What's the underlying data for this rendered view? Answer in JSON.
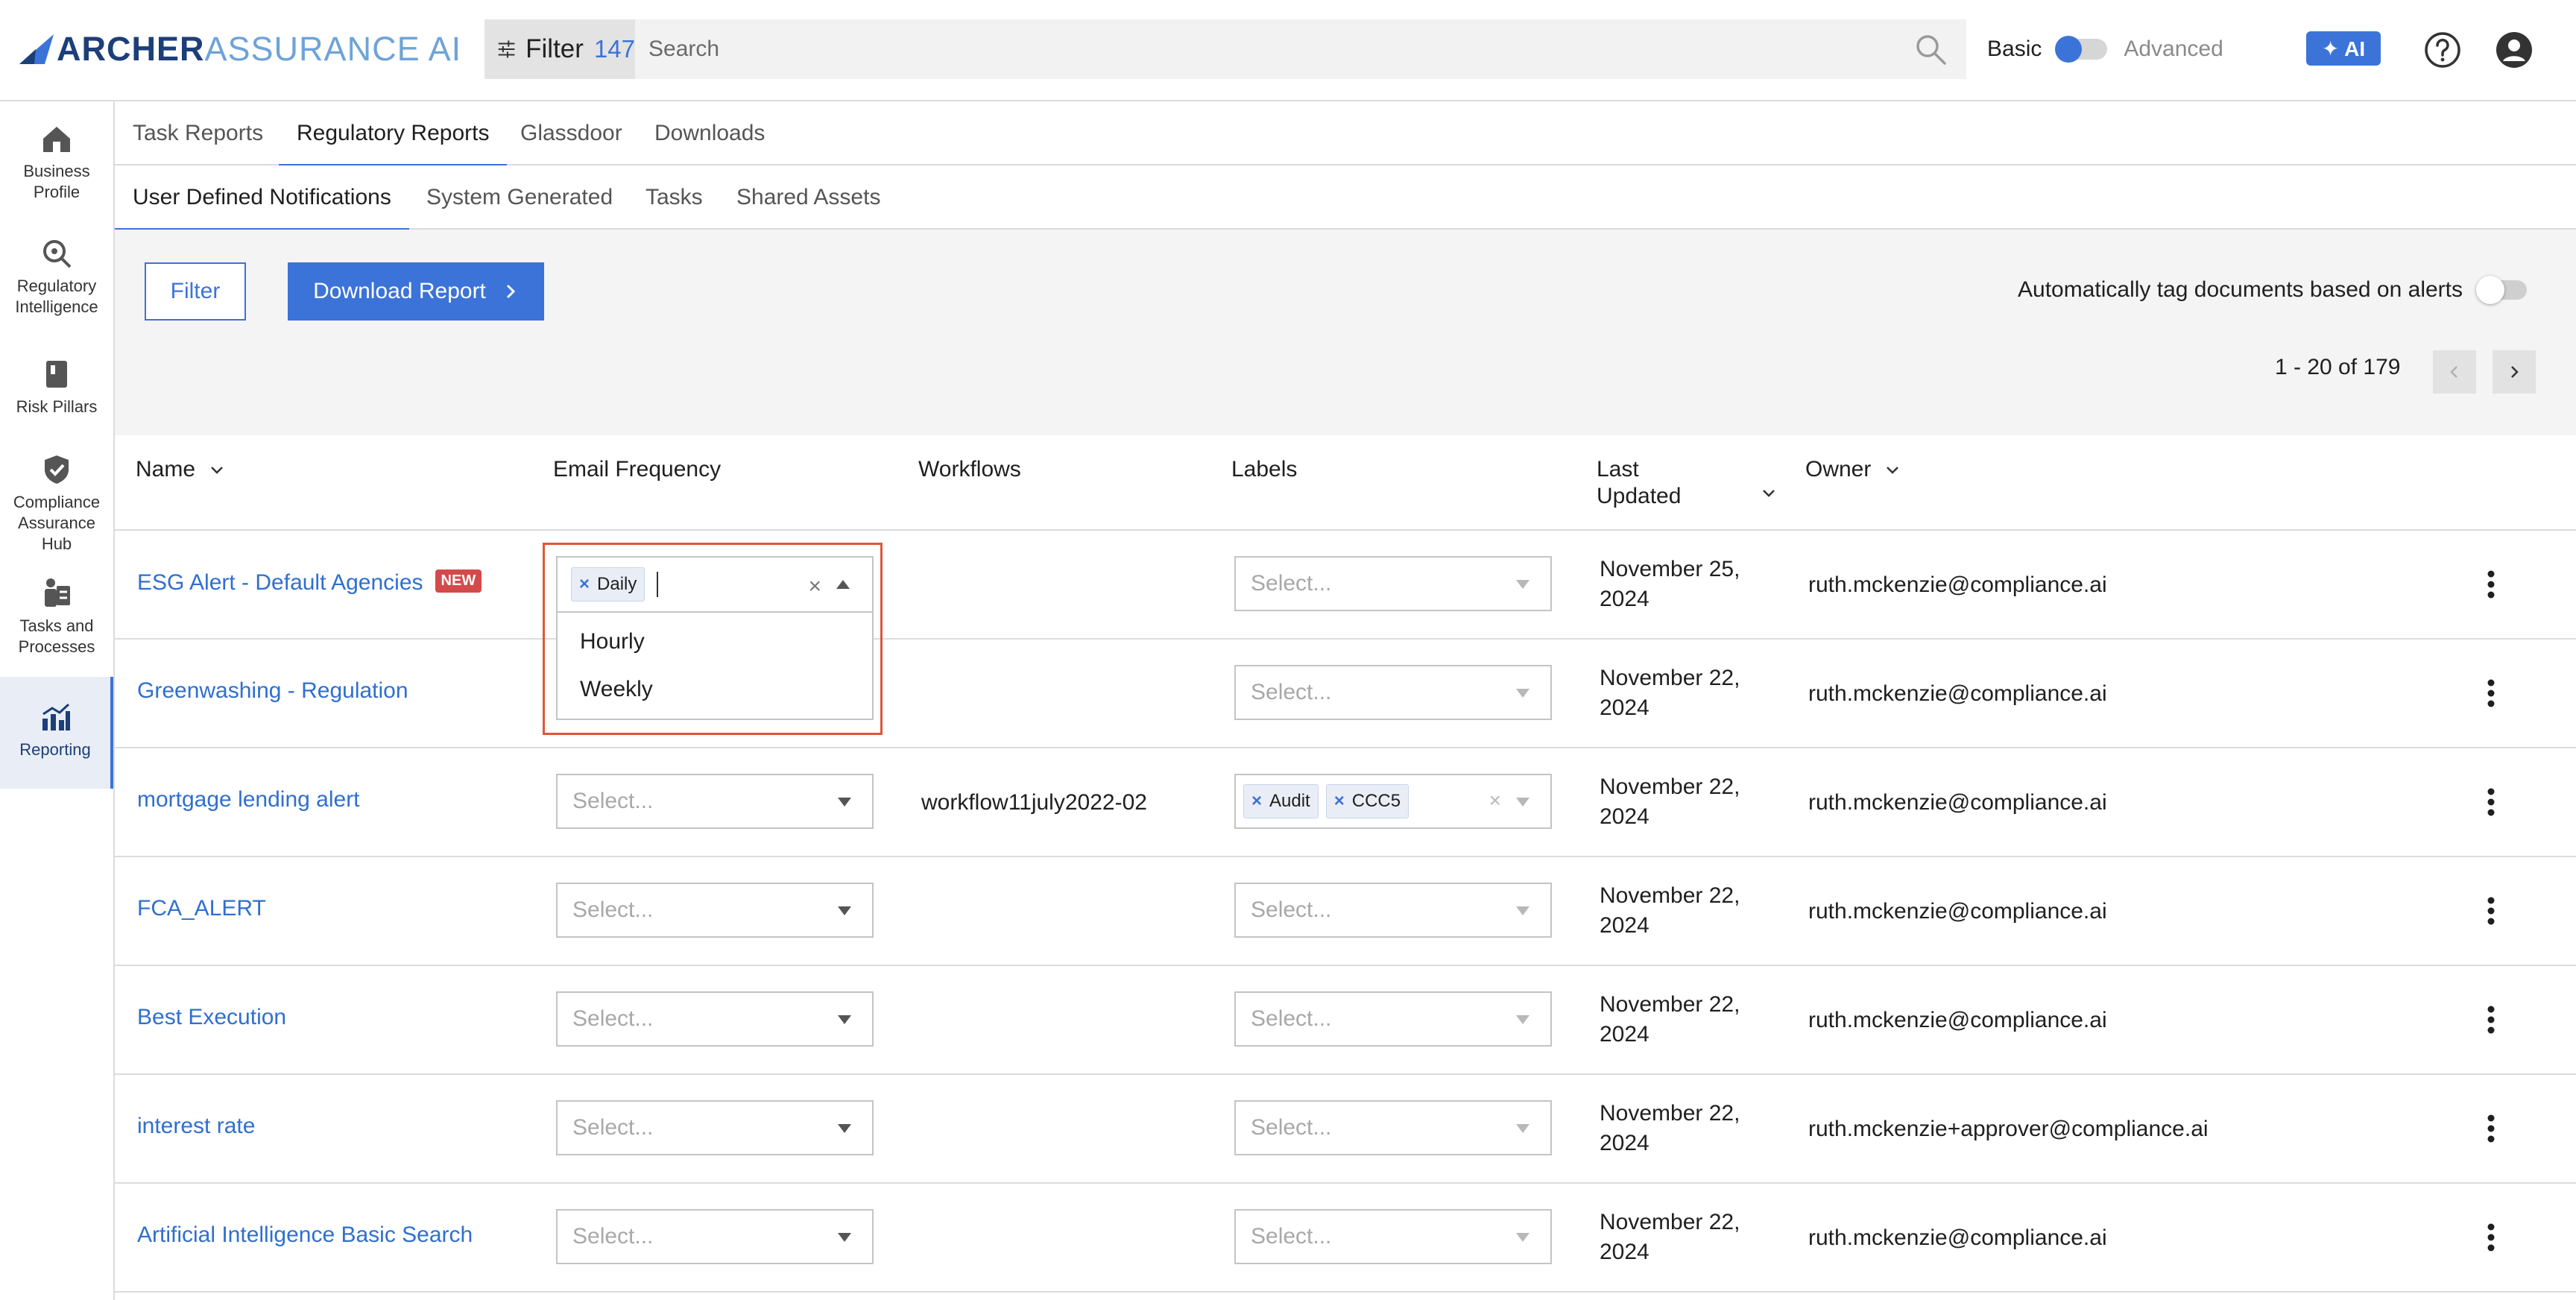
{
  "app": {
    "logo_primary": "ARCHER",
    "logo_secondary": "ASSURANCE AI"
  },
  "topbar": {
    "filter_label": "Filter",
    "filter_count": "147",
    "search_placeholder": "Search",
    "mode_basic": "Basic",
    "mode_advanced": "Advanced",
    "mode_selected": "Basic",
    "ai_label": "✦ AI",
    "accent_color": "#3b73d8"
  },
  "sidebar": {
    "items": [
      {
        "label": "Business Profile",
        "icon": "home-icon"
      },
      {
        "label": "Regulatory Intelligence",
        "icon": "magnifier-icon"
      },
      {
        "label": "Risk Pillars",
        "icon": "book-icon"
      },
      {
        "label": "Compliance Assurance Hub",
        "icon": "shield-check-icon"
      },
      {
        "label": "Tasks and Processes",
        "icon": "tasks-icon"
      },
      {
        "label": "Reporting",
        "icon": "chart-icon",
        "active": true
      }
    ]
  },
  "tabs": {
    "primary": [
      "Task Reports",
      "Regulatory Reports",
      "Glassdoor",
      "Downloads"
    ],
    "primary_active": "Regulatory Reports",
    "secondary": [
      "User Defined Notifications",
      "System Generated",
      "Tasks",
      "Shared Assets"
    ],
    "secondary_active": "User Defined Notifications"
  },
  "toolbar": {
    "filter_button": "Filter",
    "download_button": "Download Report",
    "autotag_label": "Automatically tag documents based on alerts",
    "autotag_enabled": false,
    "pagination": "1 - 20 of 179"
  },
  "table": {
    "headers": {
      "name": "Name",
      "email_frequency": "Email Frequency",
      "workflows": "Workflows",
      "labels": "Labels",
      "last_updated": "Last Updated",
      "owner": "Owner"
    },
    "select_placeholder": "Select...",
    "rows": [
      {
        "name": "ESG Alert - Default Agencies",
        "badge": "NEW",
        "email_frequency": [
          "Daily"
        ],
        "workflow": "",
        "labels": [],
        "last_updated_l1": "November 25,",
        "last_updated_l2": "2024",
        "owner": "ruth.mckenzie@compliance.ai"
      },
      {
        "name": "Greenwashing - Regulation",
        "badge": "",
        "email_frequency": [],
        "workflow": "",
        "labels": [],
        "last_updated_l1": "November 22,",
        "last_updated_l2": "2024",
        "owner": "ruth.mckenzie@compliance.ai"
      },
      {
        "name": "mortgage lending alert",
        "badge": "",
        "email_frequency": [],
        "workflow": "workflow11july2022-02",
        "labels": [
          "Audit",
          "CCC5"
        ],
        "last_updated_l1": "November 22,",
        "last_updated_l2": "2024",
        "owner": "ruth.mckenzie@compliance.ai"
      },
      {
        "name": "FCA_ALERT",
        "badge": "",
        "email_frequency": [],
        "workflow": "",
        "labels": [],
        "last_updated_l1": "November 22,",
        "last_updated_l2": "2024",
        "owner": "ruth.mckenzie@compliance.ai"
      },
      {
        "name": "Best Execution",
        "badge": "",
        "email_frequency": [],
        "workflow": "",
        "labels": [],
        "last_updated_l1": "November 22,",
        "last_updated_l2": "2024",
        "owner": "ruth.mckenzie@compliance.ai"
      },
      {
        "name": "interest rate",
        "badge": "",
        "email_frequency": [],
        "workflow": "",
        "labels": [],
        "last_updated_l1": "November 22,",
        "last_updated_l2": "2024",
        "owner": "ruth.mckenzie+approver@compliance.ai"
      },
      {
        "name": "Artificial Intelligence Basic Search",
        "badge": "",
        "email_frequency": [],
        "workflow": "",
        "labels": [],
        "last_updated_l1": "November 22,",
        "last_updated_l2": "2024",
        "owner": "ruth.mckenzie@compliance.ai"
      }
    ]
  },
  "email_dropdown": {
    "selected_chip": "Daily",
    "options": [
      "Hourly",
      "Weekly"
    ]
  }
}
